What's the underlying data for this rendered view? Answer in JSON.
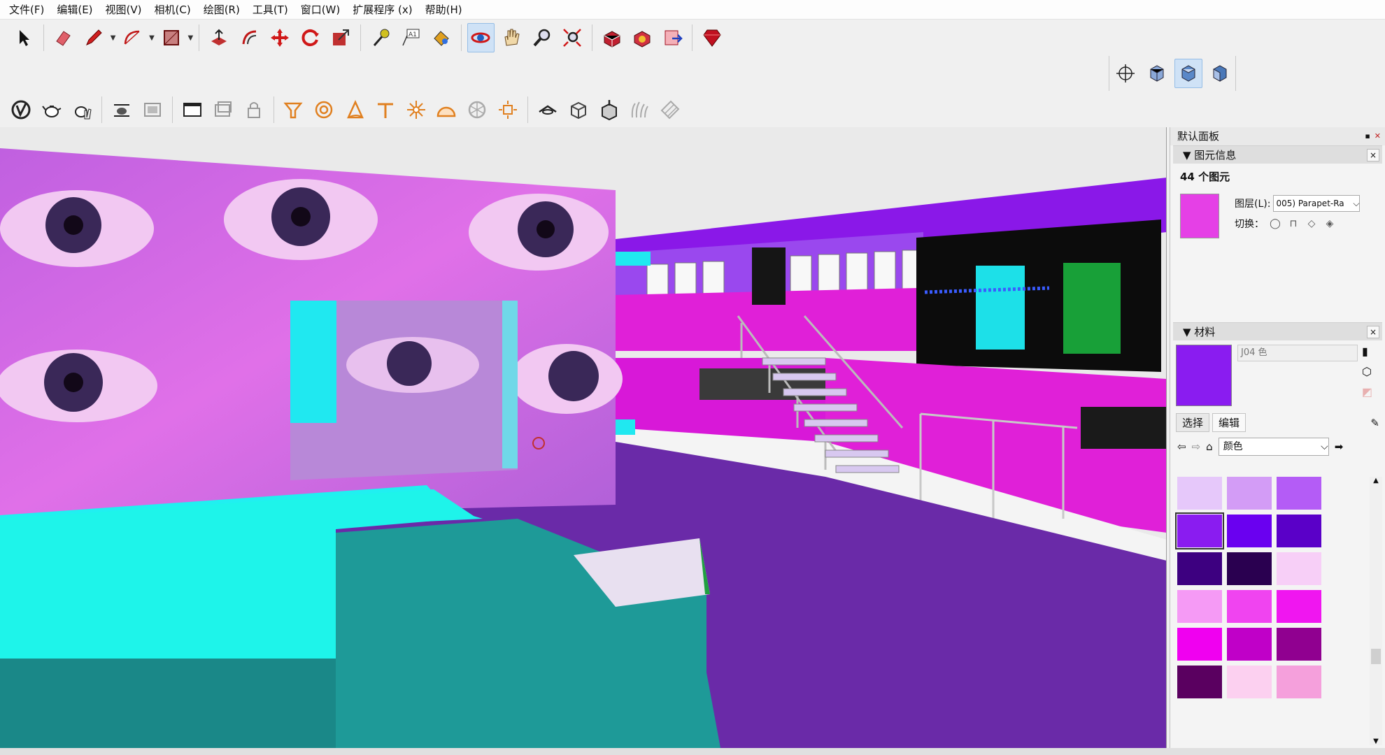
{
  "menu": [
    "文件(F)",
    "编辑(E)",
    "视图(V)",
    "相机(C)",
    "绘图(R)",
    "工具(T)",
    "窗口(W)",
    "扩展程序 (x)",
    "帮助(H)"
  ],
  "toolbar1": [
    "select-tool-icon",
    "eraser-tool-icon",
    "pencil-line-tool-icon",
    "arc-tool-icon",
    "rectangle-tool-icon",
    "push-pull-tool-icon",
    "offset-tool-icon",
    "move-tool-icon",
    "rotate-tool-icon",
    "scale-tool-icon",
    "tape-measure-tool-icon",
    "text-tool-icon",
    "paint-bucket-tool-icon",
    "orbit-tool-icon",
    "pan-tool-icon",
    "zoom-tool-icon",
    "zoom-extents-tool-icon",
    "3d-warehouse-icon",
    "extension-warehouse-icon",
    "layout-send-icon",
    "ruby-console-icon"
  ],
  "toolbar2": [
    "vray-logo-icon",
    "teapot-render-icon",
    "interactive-render-icon",
    "frame-buffer-icon",
    "batch-render-icon",
    "window-icon",
    "camera-icon",
    "lock-icon",
    "spot-light-icon",
    "sphere-light-icon",
    "rect-light-icon",
    "ies-light-icon",
    "omni-light-icon",
    "dome-light-icon",
    "mesh-light-icon",
    "sun-icon",
    "proxy-icon",
    "box-icon",
    "clip-icon",
    "fur-icon",
    "plane-icon"
  ],
  "views": [
    "center-view-icon",
    "iso-view-icon",
    "top-view-icon",
    "front-view-icon"
  ],
  "panel": {
    "title": "默认面板",
    "entity_info": {
      "header": "▼ 图元信息",
      "count": "44 个图元",
      "layer_label": "图层(L):",
      "layer_value": "005) Parapet-Ra",
      "toggle_label": "切换：",
      "color": "#e540e6"
    },
    "materials": {
      "header": "▼ 材料",
      "name": "J04 色",
      "color": "#8a1cf0",
      "tab_select": "选择",
      "tab_edit": "编辑",
      "library": "颜色",
      "swatches": [
        "#e6c8fa",
        "#d39cf6",
        "#b45cf6",
        "#8a1cf0",
        "#6a00f0",
        "#5a00c8",
        "#3d0080",
        "#2a0050",
        "#f7cff7",
        "#f59af5",
        "#f044f0",
        "#f016f0",
        "#f000f0",
        "#c000c8",
        "#900090",
        "#5a0060",
        "#fcd0f0",
        "#f5a0dc"
      ],
      "selected_index": 3
    }
  }
}
